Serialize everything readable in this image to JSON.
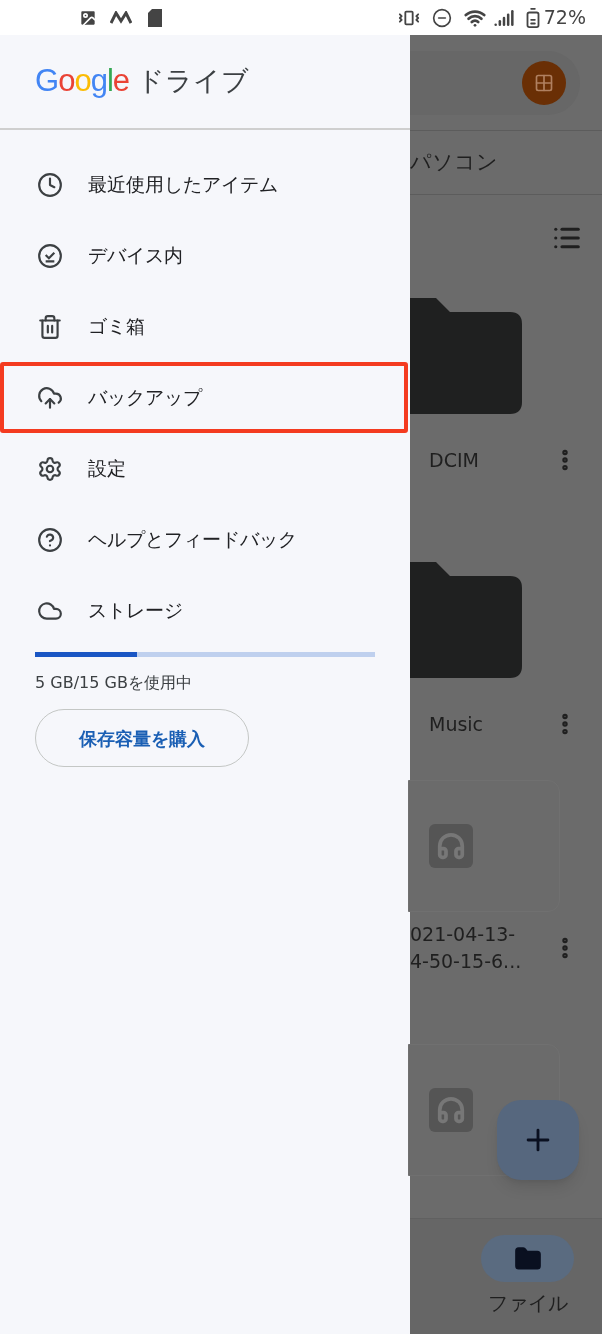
{
  "status_bar": {
    "battery": "72%"
  },
  "drawer": {
    "logo": "Google",
    "title": "ドライブ",
    "items": [
      {
        "kind": "recent",
        "label": "最近使用したアイテム",
        "highlighted": false
      },
      {
        "kind": "device",
        "label": "デバイス内",
        "highlighted": false
      },
      {
        "kind": "trash",
        "label": "ゴミ箱",
        "highlighted": false
      },
      {
        "kind": "backup",
        "label": "バックアップ",
        "highlighted": true
      },
      {
        "kind": "settings",
        "label": "設定",
        "highlighted": false
      },
      {
        "kind": "help",
        "label": "ヘルプとフィードバック",
        "highlighted": false
      },
      {
        "kind": "storage",
        "label": "ストレージ",
        "highlighted": false
      }
    ],
    "storage": {
      "level": 0.3,
      "usage": "5 GB/15 GBを使用中",
      "button": "保存容量を購入"
    }
  },
  "background": {
    "tab": "パソコン",
    "folders": [
      {
        "name": "DCIM"
      },
      {
        "name": "Music"
      }
    ],
    "files": [
      {
        "kind": "audio",
        "lines": [
          "021-04-13-",
          "4-50-15-6..."
        ]
      },
      {
        "kind": "audio"
      }
    ],
    "nav": {
      "label": "ファイル"
    }
  }
}
